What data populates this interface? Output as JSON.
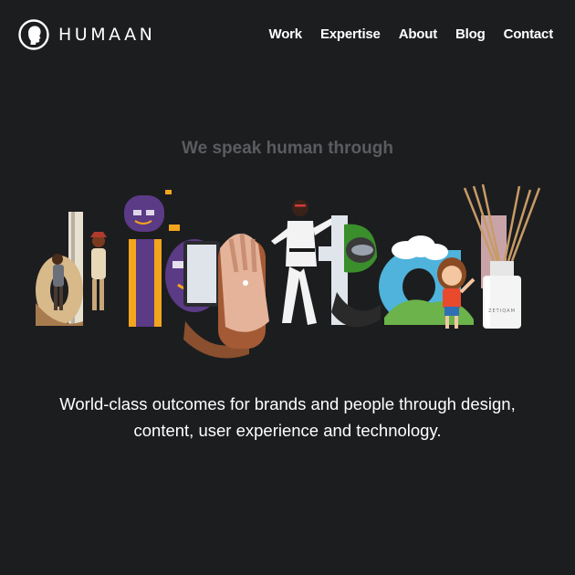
{
  "header": {
    "logo_text": "HUMAAN",
    "logo_icon": "human-head-icon",
    "nav": [
      "Work",
      "Expertise",
      "About",
      "Blog",
      "Contact"
    ]
  },
  "hero": {
    "tagline": "We speak human through",
    "word": "digital",
    "bottle_label": "ZETIQAM",
    "description_line1": "World-class outcomes for brands and people through design,",
    "description_line2": "content, user experience and technology."
  },
  "colors": {
    "background": "#1c1d1f",
    "text": "#ffffff",
    "tagline": "#5a5c5f",
    "purple": "#5b3a86",
    "orange": "#f2a51d",
    "blue": "#4fb3dc",
    "green": "#6bb34a",
    "brown": "#8a4f2e"
  }
}
